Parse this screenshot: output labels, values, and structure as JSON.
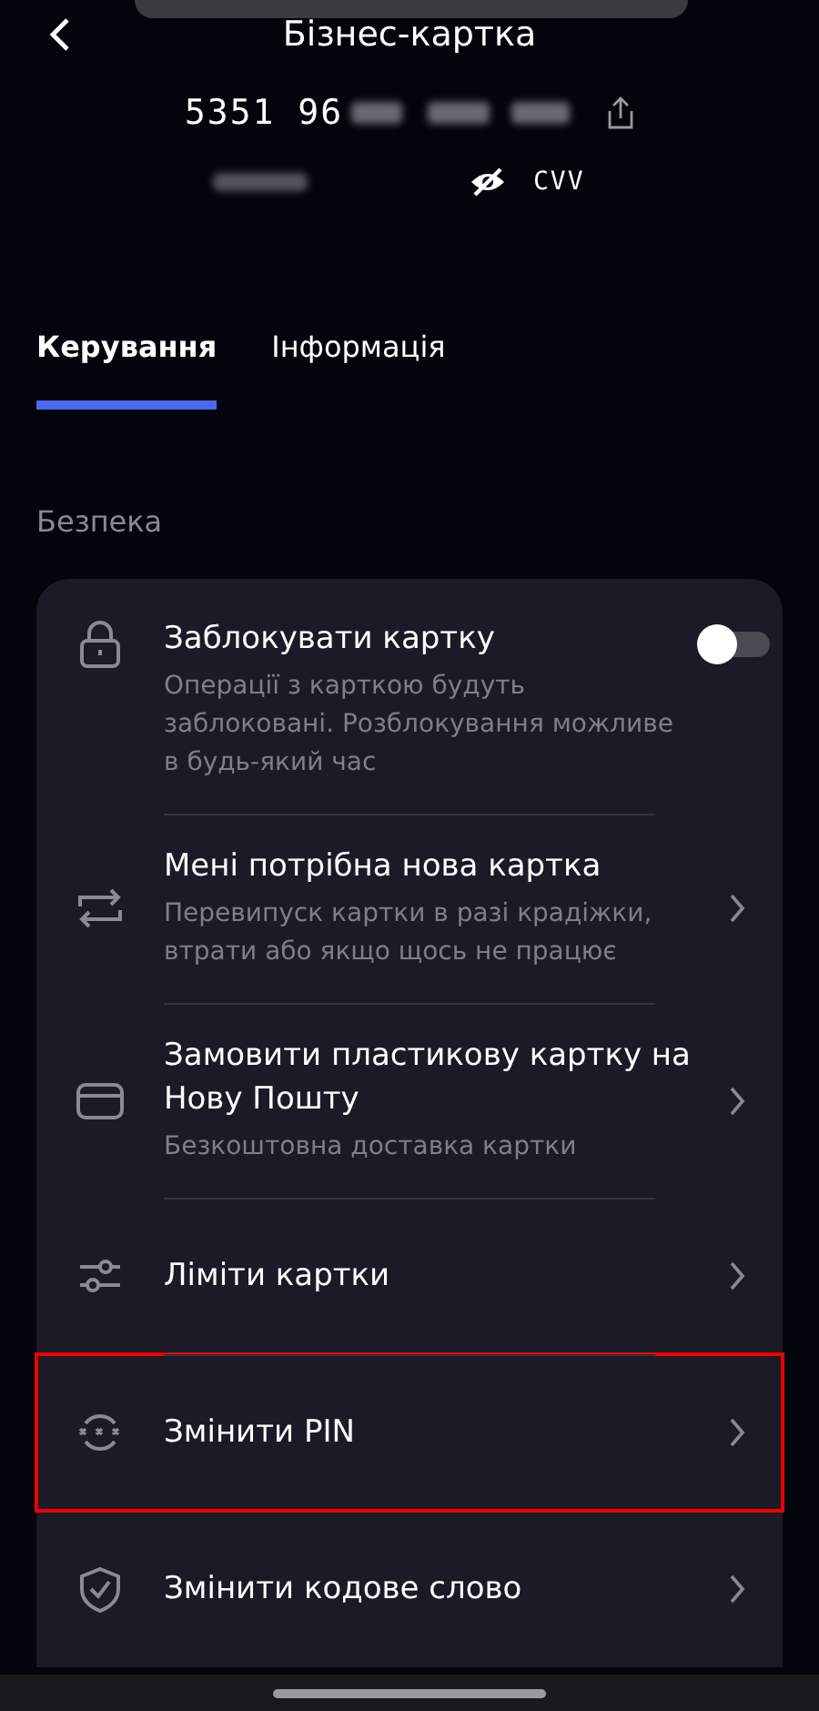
{
  "header": {
    "title": "Бізнес-картка",
    "card_number_visible": "5351 96",
    "cvv_label": "CVV",
    "cvv_hidden": true
  },
  "tabs": [
    {
      "label": "Керування",
      "selected": true
    },
    {
      "label": "Інформація",
      "selected": false
    }
  ],
  "section_title": "Безпека",
  "items": [
    {
      "kind": "toggle",
      "title": "Заблокувати картку",
      "subtitle": "Операції з карткою будуть заблоковані. Розблокування можливе в будь-який час",
      "on": false,
      "highlighted": false
    },
    {
      "kind": "link",
      "title": "Мені потрібна нова картка",
      "subtitle": "Перевипуск картки в разі крадіжки, втрати або якщо щось не працює",
      "highlighted": false
    },
    {
      "kind": "link",
      "title": "Замовити пластикову картку на Нову Пошту",
      "subtitle": "Безкоштовна доставка картки",
      "highlighted": false
    },
    {
      "kind": "link",
      "title": "Ліміти картки",
      "highlighted": false
    },
    {
      "kind": "link",
      "title": "Змінити PIN",
      "highlighted": true
    },
    {
      "kind": "link",
      "title": "Змінити кодове слово",
      "highlighted": false
    }
  ]
}
